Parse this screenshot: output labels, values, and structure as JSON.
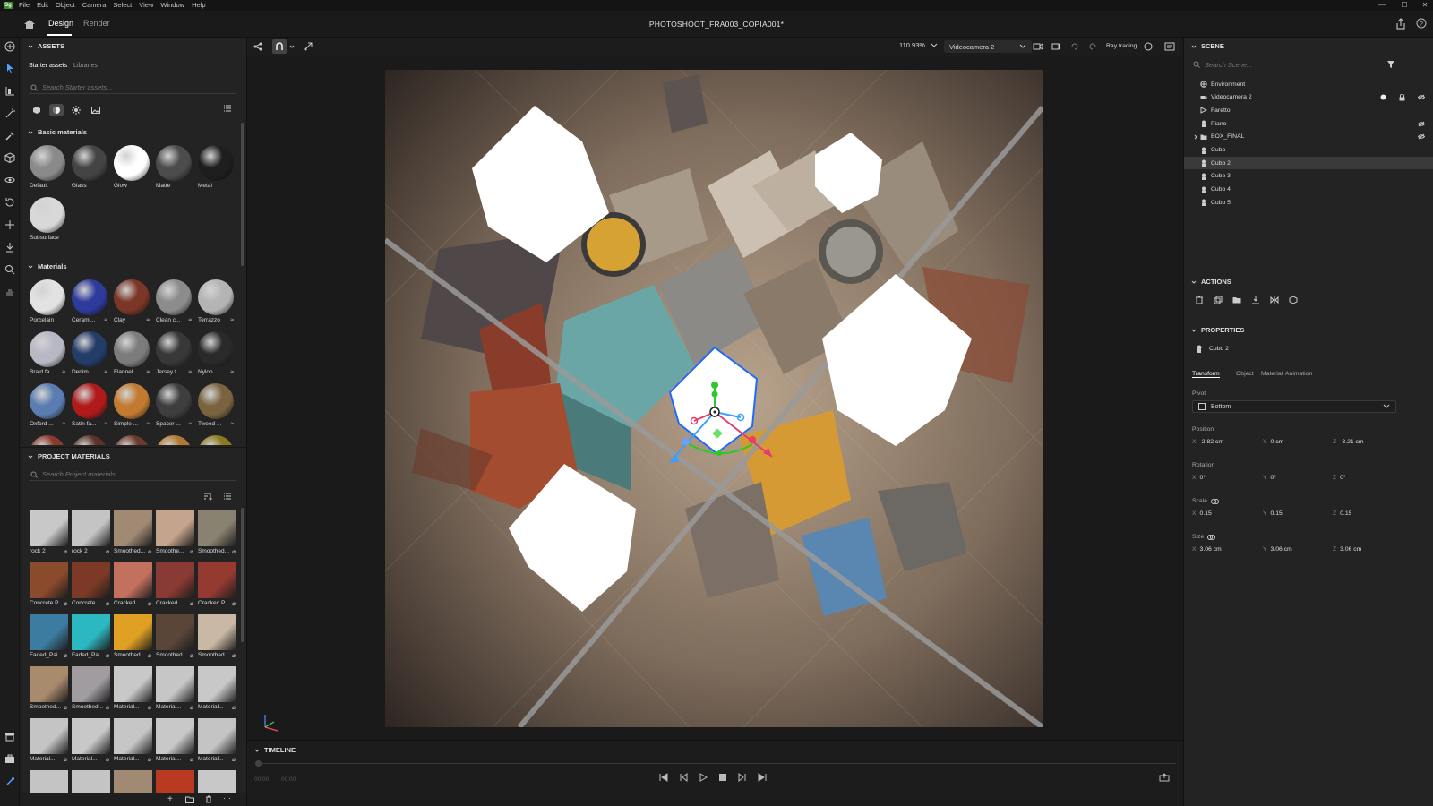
{
  "menubar": {
    "logo": "Sg",
    "items": [
      "File",
      "Edit",
      "Object",
      "Camera",
      "Select",
      "View",
      "Window",
      "Help"
    ]
  },
  "titlebar": {
    "tabs": [
      "Design",
      "Render"
    ],
    "active_tab": "Design",
    "document_title": "PHOTOSHOOT_FRA003_COPIA001*"
  },
  "assets": {
    "title": "ASSETS",
    "subtabs": [
      "Starter assets",
      "Libraries"
    ],
    "search_placeholder": "Search Starter assets...",
    "basic_title": "Basic materials",
    "basic": [
      {
        "label": "Default",
        "color": "#8a8a8a"
      },
      {
        "label": "Glass",
        "color": "#444444"
      },
      {
        "label": "Glow",
        "color": "#ffffff"
      },
      {
        "label": "Matte",
        "color": "#4c4c4c"
      },
      {
        "label": "Metal",
        "color": "#1e1e1e"
      },
      {
        "label": "Subsurface",
        "color": "#d8d8d8"
      }
    ],
    "materials_title": "Materials",
    "materials": [
      {
        "label": "Porcelain",
        "color": "#e2e2e2",
        "sub": ""
      },
      {
        "label": "Cerami...",
        "color": "#2e3a9c",
        "sub": "≈"
      },
      {
        "label": "Clay",
        "color": "#7a3626",
        "sub": "≈"
      },
      {
        "label": "Clean c...",
        "color": "#8c8c8c",
        "sub": "≈"
      },
      {
        "label": "Terrazzo",
        "color": "#b4b4b4",
        "sub": "≈"
      },
      {
        "label": "Braid fa...",
        "color": "#b8b8c4",
        "sub": "≈"
      },
      {
        "label": "Denim ...",
        "color": "#243c68",
        "sub": "≈"
      },
      {
        "label": "Flannel...",
        "color": "#7c7c7c",
        "sub": "≈"
      },
      {
        "label": "Jersey f...",
        "color": "#383838",
        "sub": "≈"
      },
      {
        "label": "Nylon ...",
        "color": "#2a2a2a",
        "sub": "≈"
      },
      {
        "label": "Oxford ...",
        "color": "#5a7cb0",
        "sub": "≈"
      },
      {
        "label": "Satin fa...",
        "color": "#b01a1a",
        "sub": "≈"
      },
      {
        "label": "Simple ...",
        "color": "#c27a30",
        "sub": "≈"
      },
      {
        "label": "Spacer ...",
        "color": "#3e3e3e",
        "sub": "≈"
      },
      {
        "label": "Tweed ...",
        "color": "#7a6440",
        "sub": "≈"
      }
    ],
    "materials_partial_colors": [
      "#8a3a2a",
      "#5a3428",
      "#6a3a2a",
      "#b07830",
      "#8a7a20"
    ],
    "project_title": "PROJECT MATERIALS",
    "project_search_placeholder": "Search Project materials...",
    "project": [
      {
        "label": "rock 2",
        "color": "#c8c8c8"
      },
      {
        "label": "rock 2",
        "color": "#c4c4c4"
      },
      {
        "label": "Smoothed...",
        "color": "#a08a74"
      },
      {
        "label": "Smoothe...",
        "color": "#c4a48c"
      },
      {
        "label": "Smoothed...",
        "color": "#8a8270"
      },
      {
        "label": "Concrete P...",
        "color": "#8a4a2c"
      },
      {
        "label": "Concrete...",
        "color": "#7c3a26"
      },
      {
        "label": "Cracked ...",
        "color": "#c4705e"
      },
      {
        "label": "Cracked ...",
        "color": "#8a3a34"
      },
      {
        "label": "Cracked P...",
        "color": "#943a30"
      },
      {
        "label": "Faded_Pai...",
        "color": "#3c7ca0"
      },
      {
        "label": "Faded_Pai...",
        "color": "#2cb8c0"
      },
      {
        "label": "Smoothed...",
        "color": "#e0a024"
      },
      {
        "label": "Smoothed...",
        "color": "#5a4638"
      },
      {
        "label": "Smoothed...",
        "color": "#c8b8a4"
      },
      {
        "label": "Smoothed...",
        "color": "#a88a6c"
      },
      {
        "label": "Smoothed...",
        "color": "#a09ca0"
      },
      {
        "label": "Material...",
        "color": "#c8c8c8"
      },
      {
        "label": "Material...",
        "color": "#c6c6c6"
      },
      {
        "label": "Material...",
        "color": "#c8c8c8"
      },
      {
        "label": "Material...",
        "color": "#c4c4c4"
      },
      {
        "label": "Material...",
        "color": "#c8c8c8"
      },
      {
        "label": "Material...",
        "color": "#c6c6c6"
      },
      {
        "label": "Material...",
        "color": "#c8c8c8"
      },
      {
        "label": "Material...",
        "color": "#c4c4c4"
      }
    ],
    "project_partial_colors": [
      "#c4c4c4",
      "#c4c4c4",
      "#a08a74",
      "#b83a20",
      "#c8c8c8"
    ]
  },
  "viewport": {
    "zoom": "110.93%",
    "camera": "Videocamera 2",
    "ray_tracing_label": "Ray tracing",
    "ray_tracing_on": false
  },
  "timeline": {
    "title": "TIMELINE",
    "time_start": "00:00",
    "time_end": "00:00"
  },
  "scene": {
    "title": "SCENE",
    "search_placeholder": "Search Scene...",
    "items": [
      {
        "label": "Environment",
        "icon": "globe-icon"
      },
      {
        "label": "Videocamera 2",
        "icon": "camera-icon"
      },
      {
        "label": "Faretto",
        "icon": "spotlight-icon"
      },
      {
        "label": "Piano",
        "icon": "model-icon"
      },
      {
        "label": "BOX_FINAL",
        "icon": "folder-icon"
      },
      {
        "label": "Cubo",
        "icon": "model-icon"
      },
      {
        "label": "Cubo 2",
        "icon": "model-icon",
        "selected": true
      },
      {
        "label": "Cubo 3",
        "icon": "model-icon"
      },
      {
        "label": "Cubo 4",
        "icon": "model-icon"
      },
      {
        "label": "Cubo 5",
        "icon": "model-icon"
      }
    ]
  },
  "actions": {
    "title": "ACTIONS"
  },
  "properties": {
    "title": "PROPERTIES",
    "object_name": "Cubo 2",
    "tabs": [
      "Transform",
      "Object",
      "Material",
      "Animation"
    ],
    "active_tab": "Transform",
    "pivot_label": "Pivot",
    "pivot_value": "Bottom",
    "position_label": "Position",
    "position": {
      "x": "-2.82 cm",
      "y": "0 cm",
      "z": "-3.21 cm"
    },
    "rotation_label": "Rotation",
    "rotation": {
      "x": "0°",
      "y": "0°",
      "z": "0°"
    },
    "scale_label": "Scale",
    "scale": {
      "x": "0.15",
      "y": "0.15",
      "z": "0.15"
    },
    "size_label": "Size",
    "size": {
      "x": "3.06 cm",
      "y": "3.06 cm",
      "z": "3.06 cm"
    },
    "axes": [
      "X",
      "Y",
      "Z"
    ]
  }
}
